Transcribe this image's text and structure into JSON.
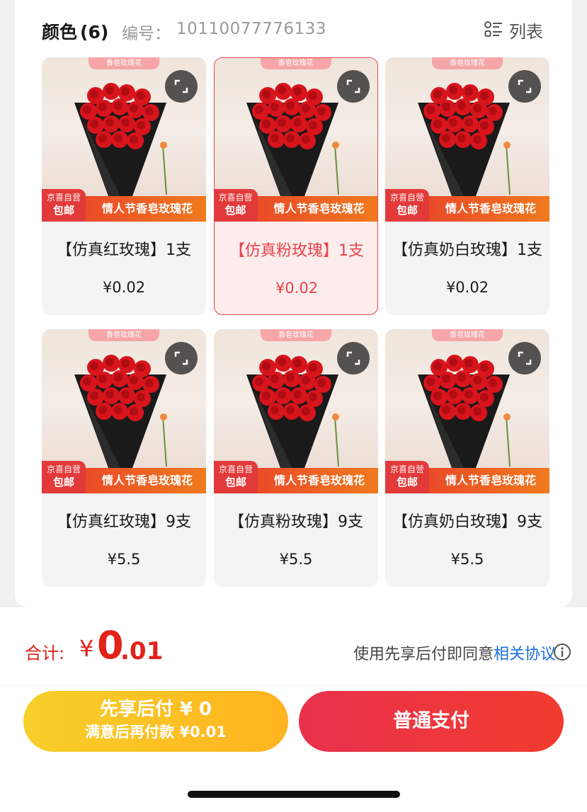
{
  "header": {
    "title": "颜色",
    "count": "(6)",
    "code_label": "编号：",
    "code_value": "10110077776133",
    "view_toggle_label": "列表",
    "view_toggle_icon": "list-icon"
  },
  "products": [
    {
      "thumb_tag": "香皂玫瑰花",
      "badge_top": "京喜自营",
      "badge_bottom": "包邮",
      "banner": "情人节香皂玫瑰花",
      "name": "【仿真红玫瑰】1支",
      "price": "¥0.02",
      "selected": false
    },
    {
      "thumb_tag": "香皂玫瑰花",
      "badge_top": "京喜自营",
      "badge_bottom": "包邮",
      "banner": "情人节香皂玫瑰花",
      "name": "【仿真粉玫瑰】1支",
      "price": "¥0.02",
      "selected": true
    },
    {
      "thumb_tag": "香皂玫瑰花",
      "badge_top": "京喜自营",
      "badge_bottom": "包邮",
      "banner": "情人节香皂玫瑰花",
      "name": "【仿真奶白玫瑰】1支",
      "price": "¥0.02",
      "selected": false
    },
    {
      "thumb_tag": "香皂玫瑰花",
      "badge_top": "京喜自营",
      "badge_bottom": "包邮",
      "banner": "情人节香皂玫瑰花",
      "name": "【仿真红玫瑰】9支",
      "price": "¥5.5",
      "selected": false
    },
    {
      "thumb_tag": "香皂玫瑰花",
      "badge_top": "京喜自营",
      "badge_bottom": "包邮",
      "banner": "情人节香皂玫瑰花",
      "name": "【仿真粉玫瑰】9支",
      "price": "¥5.5",
      "selected": false
    },
    {
      "thumb_tag": "香皂玫瑰花",
      "badge_top": "京喜自营",
      "badge_bottom": "包邮",
      "banner": "情人节香皂玫瑰花",
      "name": "【仿真奶白玫瑰】9支",
      "price": "¥5.5",
      "selected": false
    }
  ],
  "footer": {
    "total_label": "合计:",
    "total_currency": "¥",
    "total_integer": "0",
    "total_decimal": ".01",
    "agreement_text": "使用先享后付即同意",
    "agreement_link": "相关协议",
    "pay_later_line1": "先享后付 ¥ 0",
    "pay_later_line2": "满意后再付款 ¥0.01",
    "pay_normal_label": "普通支付"
  },
  "colors": {
    "accent_red": "#e2231a",
    "selected_border": "#e8434b",
    "link_blue": "#1a6fe0",
    "pay_later_yellow": "#f7cf2a",
    "pay_normal_red": "#e9314d"
  }
}
